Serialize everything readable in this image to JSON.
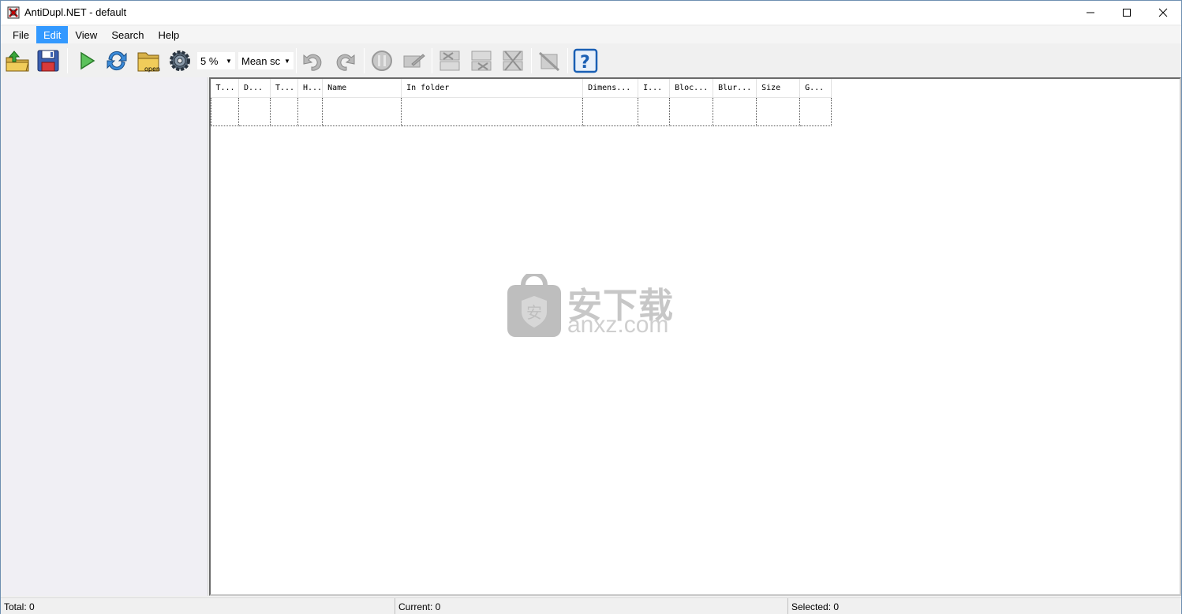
{
  "window": {
    "title": "AntiDupl.NET - default",
    "minimize_icon": "minimize-icon",
    "maximize_icon": "maximize-icon",
    "close_icon": "close-icon"
  },
  "menu": {
    "items": [
      {
        "label": "File",
        "active": false
      },
      {
        "label": "Edit",
        "active": true
      },
      {
        "label": "View",
        "active": false
      },
      {
        "label": "Search",
        "active": false
      },
      {
        "label": "Help",
        "active": false
      }
    ]
  },
  "toolbar": {
    "threshold_value": "5 %",
    "algorithm_value": "Mean sc",
    "icons": [
      "open-profile-icon",
      "save-profile-icon",
      "start-search-icon",
      "refresh-icon",
      "open-folder-icon",
      "options-icon",
      "undo-icon",
      "redo-icon",
      "stop-icon",
      "rename-icon",
      "delete-first-icon",
      "delete-second-icon",
      "delete-both-icon",
      "mistake-icon",
      "help-icon"
    ],
    "open_label": "open"
  },
  "table": {
    "columns": [
      "T...",
      "D...",
      "T...",
      "H...",
      "Name",
      "In folder",
      "Dimens...",
      "I...",
      "Bloc...",
      "Blur...",
      "Size",
      "G..."
    ]
  },
  "watermark": {
    "text": "安下载",
    "sub": "anxz.com",
    "shield_char": "安"
  },
  "status": {
    "total": "Total: 0",
    "current": "Current: 0",
    "selected": "Selected: 0"
  },
  "colors": {
    "menu_active": "#3399ff",
    "window_border": "#6e8fb1",
    "help_blue": "#1a5fb4"
  }
}
